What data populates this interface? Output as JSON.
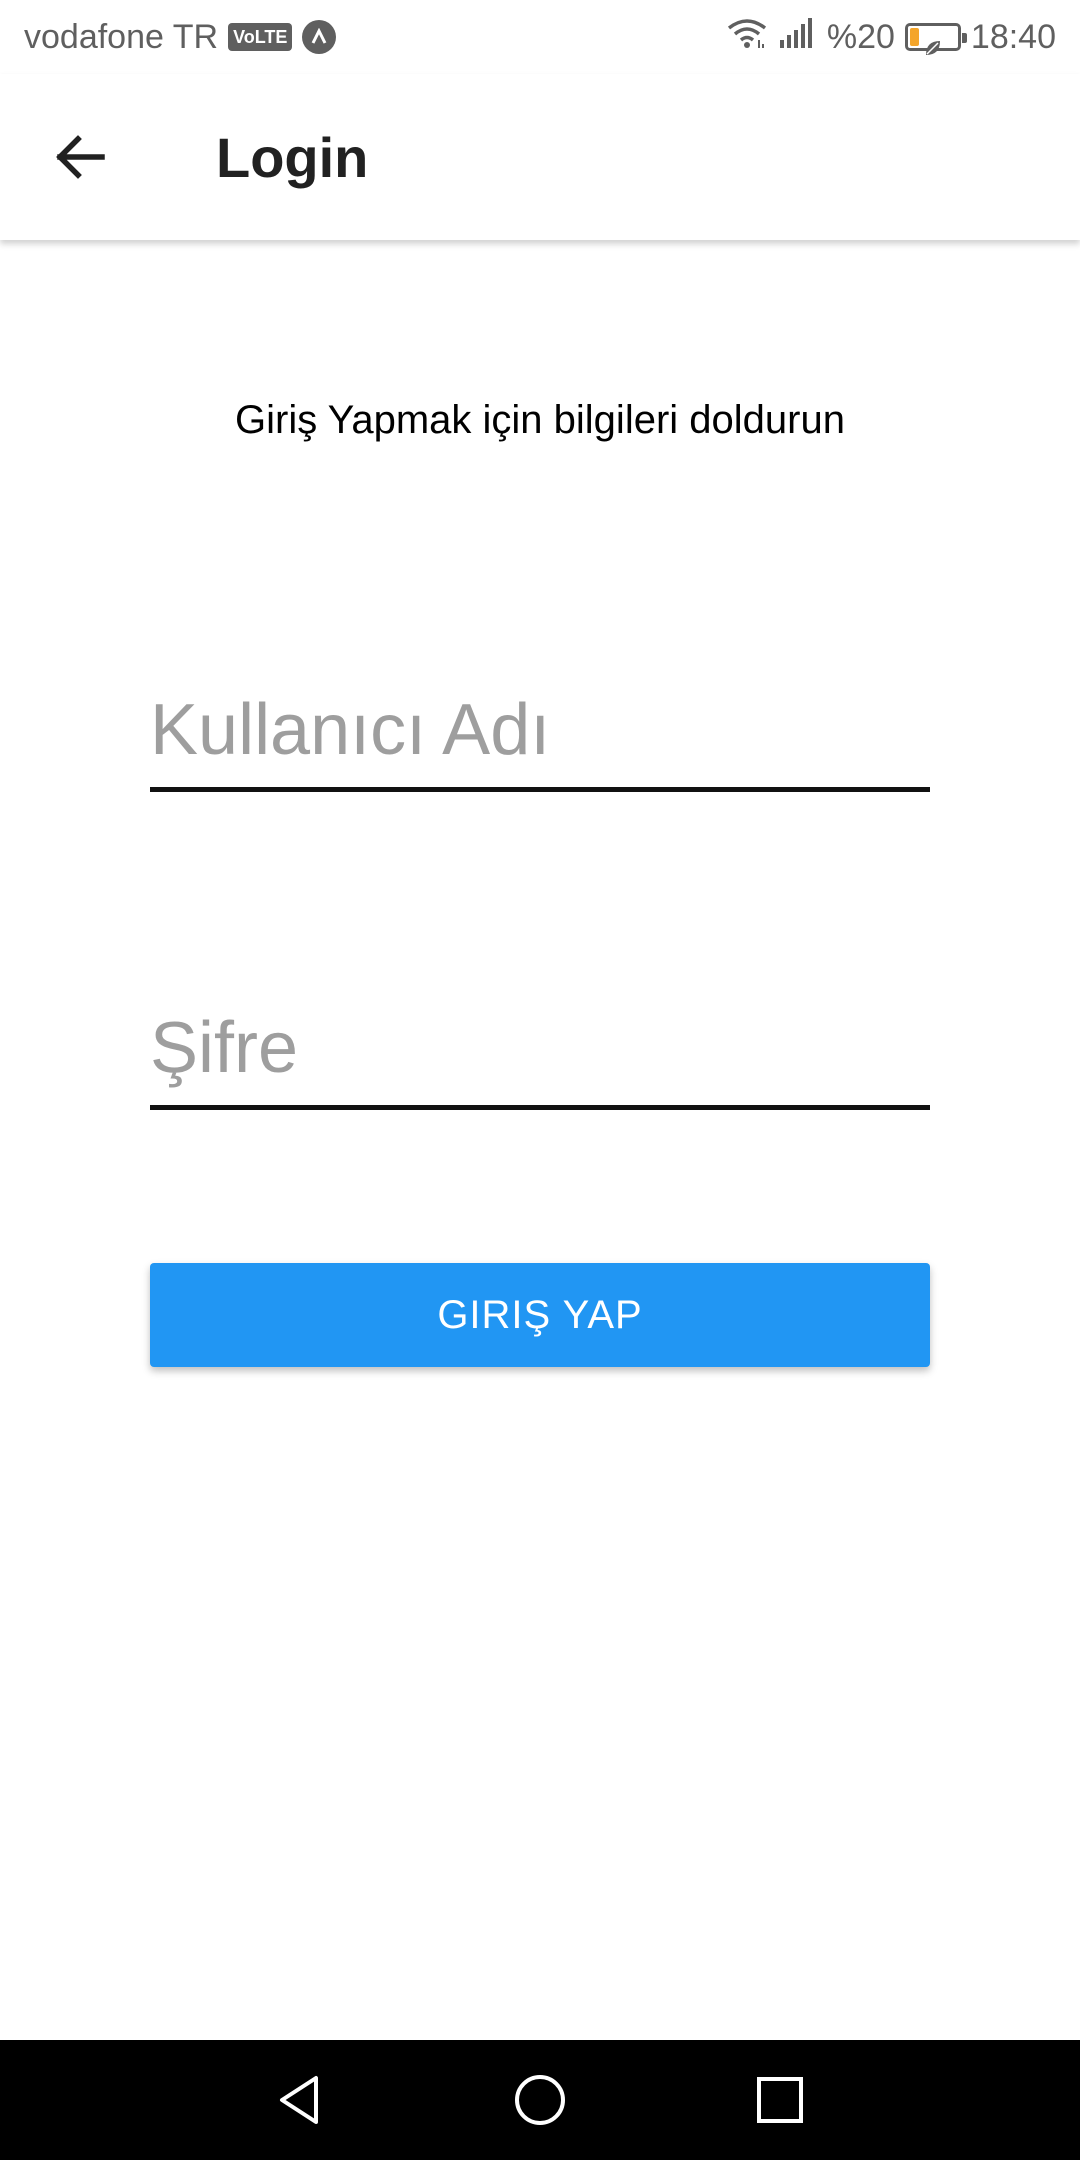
{
  "status_bar": {
    "carrier": "vodafone TR",
    "volte_badge": "VoLTE",
    "signal_icon": "signal-bars-icon",
    "wifi_icon": "wifi-icon",
    "battery_percent": "%20",
    "battery_level": 0.2,
    "time": "18:40"
  },
  "app_bar": {
    "title": "Login",
    "back_icon": "arrow-left-icon"
  },
  "form": {
    "subtitle": "Giriş Yapmak için bilgileri doldurun",
    "username_placeholder": "Kullanıcı Adı",
    "username_value": "",
    "password_placeholder": "Şifre",
    "password_value": "",
    "submit_label": "GIRIŞ YAP"
  },
  "colors": {
    "primary_button": "#2196f3",
    "input_underline": "#111111",
    "placeholder": "#9e9e9e",
    "battery_fill": "#f4a52a"
  },
  "nav_bar": {
    "back_icon": "triangle-back-icon",
    "home_icon": "circle-home-icon",
    "recents_icon": "square-recents-icon"
  }
}
